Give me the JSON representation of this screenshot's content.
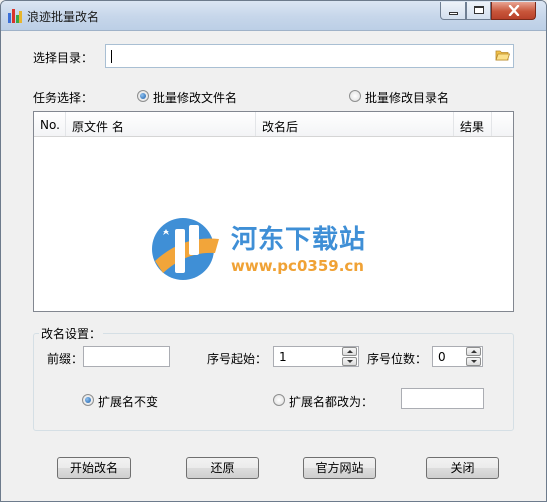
{
  "window": {
    "title": "浪迹批量改名"
  },
  "directory": {
    "label": "选择目录：",
    "value": ""
  },
  "task": {
    "label": "任务选择：",
    "options": [
      {
        "label": "批量修改文件名",
        "checked": true
      },
      {
        "label": "批量修改目录名",
        "checked": false
      }
    ]
  },
  "list": {
    "columns": [
      "No.",
      "原文件 名",
      "改名后",
      "结果"
    ],
    "rows": []
  },
  "watermark": {
    "name": "河东下载站",
    "url": "www.pc0359.cn"
  },
  "rename_settings": {
    "title": "改名设置：",
    "prefix_label": "前缀：",
    "prefix_value": "",
    "seq_start_label": "序号起始：",
    "seq_start_value": "1",
    "seq_digits_label": "序号位数：",
    "seq_digits_value": "0",
    "ext_keep_label": "扩展名不变",
    "ext_keep_checked": true,
    "ext_change_label": "扩展名都改为：",
    "ext_change_checked": false,
    "ext_change_value": ""
  },
  "buttons": {
    "start": "开始改名",
    "restore": "还原",
    "website": "官方网站",
    "close": "关闭"
  }
}
